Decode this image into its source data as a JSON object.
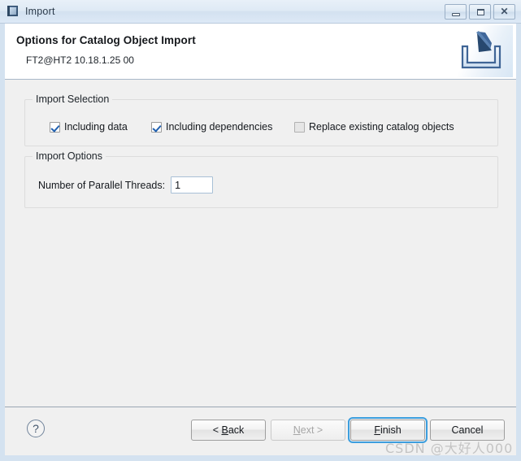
{
  "window": {
    "title": "Import",
    "icon": "import-window-icon",
    "controls": {
      "minimize_label": "",
      "maximize_label": "",
      "close_label": "✕"
    }
  },
  "header": {
    "title": "Options for Catalog Object Import",
    "subtitle": "FT2@HT2 10.18.1.25 00",
    "banner_icon": "import-arrow-tray-icon"
  },
  "groups": {
    "selection": {
      "legend": "Import Selection",
      "checkboxes": [
        {
          "label": "Including data",
          "checked": true
        },
        {
          "label": "Including dependencies",
          "checked": true
        },
        {
          "label": "Replace existing catalog objects",
          "checked": false
        }
      ]
    },
    "options": {
      "legend": "Import Options",
      "field_label": "Number of Parallel Threads:",
      "field_value": "1",
      "field_placeholder": ""
    }
  },
  "footer": {
    "help_icon": "?",
    "buttons": [
      {
        "label": "< Back",
        "accel": "B",
        "disabled": false,
        "focused": false
      },
      {
        "label": "Next >",
        "accel": "N",
        "disabled": true,
        "focused": false
      },
      {
        "label": "Finish",
        "accel": "F",
        "disabled": false,
        "focused": true
      },
      {
        "label": "Cancel",
        "accel": "",
        "disabled": false,
        "focused": false
      }
    ]
  },
  "watermark": "CSDN @大好人000",
  "colors": {
    "titlebar": "#dfeaf5",
    "window_border": "#d4e2f0",
    "dialog_bg": "#f0f0f0",
    "header_bg": "#ffffff",
    "accent_focus": "#3c9ede",
    "check_blue": "#2060b0"
  }
}
